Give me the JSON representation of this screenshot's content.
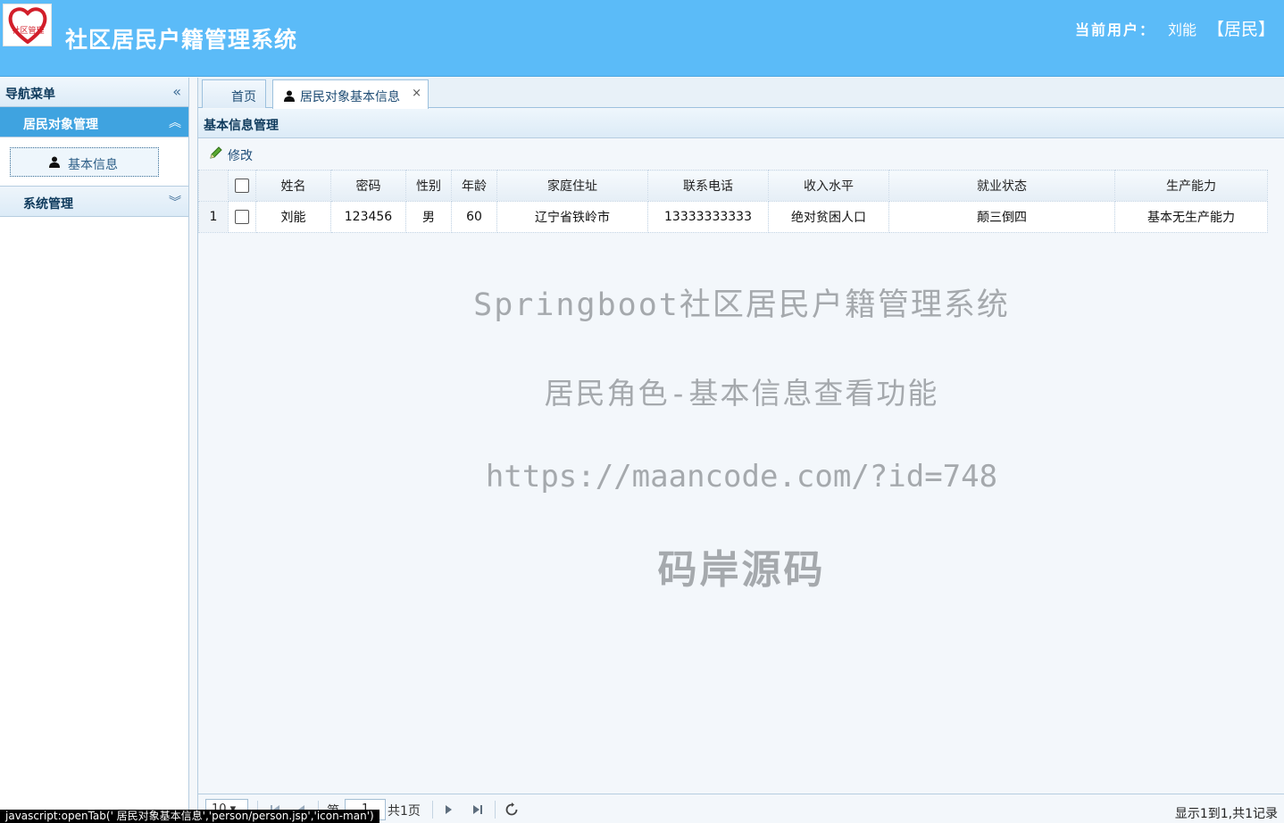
{
  "header": {
    "logo_text": "社区管理",
    "title": "社区居民户籍管理系统",
    "user_label": "当前用户：",
    "user_name": "刘能",
    "user_role": "【居民】"
  },
  "sidebar": {
    "title": "导航菜单",
    "sections": [
      {
        "label": "居民对象管理",
        "items": [
          {
            "label": "基本信息"
          }
        ]
      },
      {
        "label": "系统管理"
      }
    ]
  },
  "tabs": [
    {
      "label": "首页"
    },
    {
      "label": "居民对象基本信息"
    }
  ],
  "panel": {
    "title": "基本信息管理",
    "edit_label": "修改"
  },
  "grid": {
    "columns": [
      "姓名",
      "密码",
      "性别",
      "年龄",
      "家庭住址",
      "联系电话",
      "收入水平",
      "就业状态",
      "生产能力"
    ],
    "rows": [
      {
        "row_number": "1",
        "name": "刘能",
        "password": "123456",
        "gender": "男",
        "age": "60",
        "address": "辽宁省铁岭市",
        "phone": "13333333333",
        "income": "绝对贫困人口",
        "employment": "颠三倒四",
        "ability": "基本无生产能力"
      }
    ]
  },
  "watermark": {
    "line1": "Springboot社区居民户籍管理系统",
    "line2": "居民角色-基本信息查看功能",
    "line3": "https://maancode.com/?id=748",
    "line4": "码岸源码"
  },
  "pager": {
    "page_size": "10",
    "page_prefix": "第",
    "current_page": "1",
    "total_pages": "共1页",
    "info": "显示1到1,共1记录"
  },
  "status_bar": "javascript:openTab(' 居民对象基本信息','person/person.jsp','icon-man')"
}
